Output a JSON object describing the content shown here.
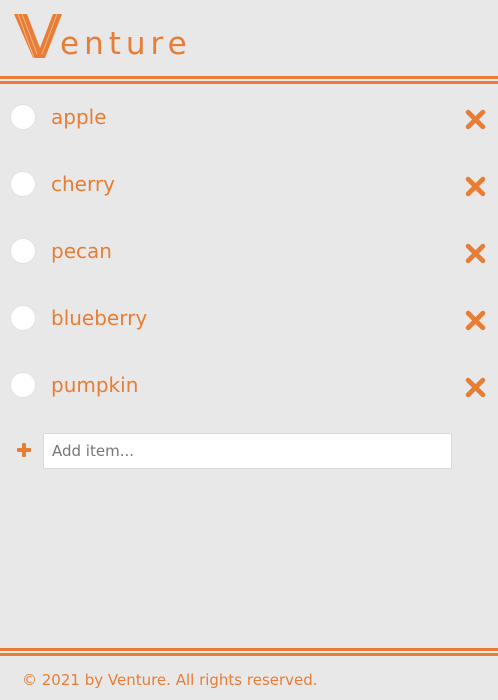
{
  "brand": {
    "logo_text": "enture",
    "logo_letter": "V",
    "accent_color": "#e87d35"
  },
  "todo": {
    "items": [
      {
        "label": "apple",
        "checked": false
      },
      {
        "label": "cherry",
        "checked": false
      },
      {
        "label": "pecan",
        "checked": false
      },
      {
        "label": "blueberry",
        "checked": false
      },
      {
        "label": "pumpkin",
        "checked": false
      }
    ],
    "add_placeholder": "Add item...",
    "add_value": ""
  },
  "icons": {
    "delete": "close-x-icon",
    "add": "plus-icon",
    "check": "circle-checkbox"
  },
  "footer": {
    "copyright_symbol": "©",
    "copyright_text": " 2021 by Venture. All rights reserved."
  }
}
